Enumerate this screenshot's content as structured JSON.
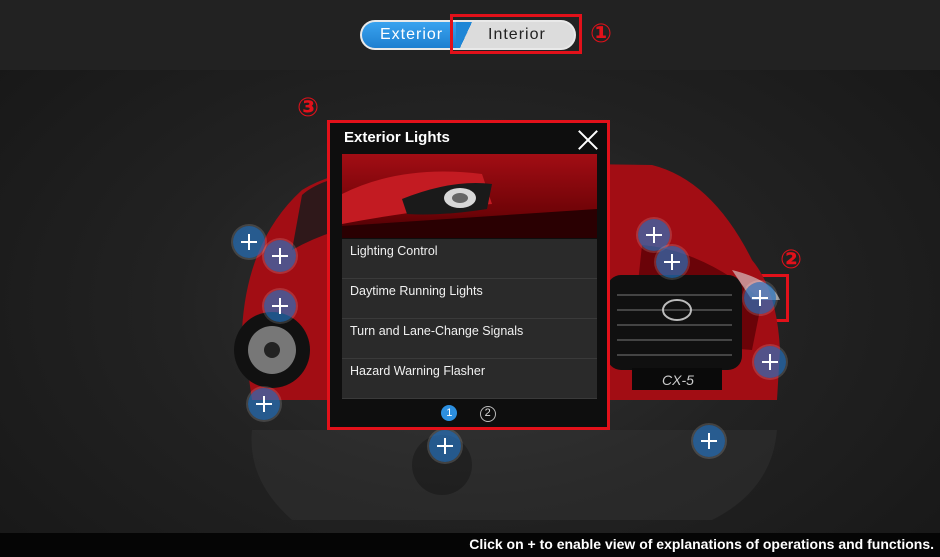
{
  "toggle": {
    "exterior_label": "Exterior",
    "interior_label": "Interior"
  },
  "markers": {
    "m1": "①",
    "m2": "②",
    "m3": "③"
  },
  "popup": {
    "title": "Exterior Lights",
    "items": [
      {
        "label": "Lighting Control"
      },
      {
        "label": "Daytime Running Lights"
      },
      {
        "label": "Turn and Lane-Change Signals"
      },
      {
        "label": "Hazard Warning Flasher"
      }
    ],
    "pages": [
      "1",
      "2"
    ],
    "active_page": "1"
  },
  "car_badge": "CX-5",
  "footer": {
    "instruction": "Click on + to enable view of explanations of operations and functions."
  },
  "colors": {
    "annotation_red": "#e2111a",
    "active_blue": "#2c8fe0",
    "hotspot_blue": "#2878c8",
    "car_red": "#a20d14"
  },
  "icons": {
    "hotspot": "plus-icon",
    "close": "close-icon"
  }
}
